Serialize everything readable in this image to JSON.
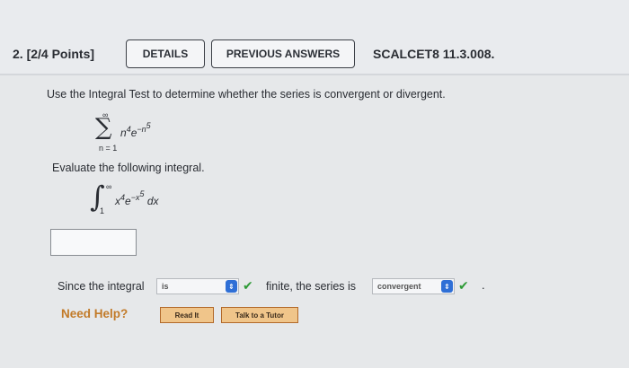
{
  "question": {
    "number": "2. [2/4 Points]",
    "details_label": "DETAILS",
    "previous_answers_label": "PREVIOUS ANSWERS",
    "code": "SCALCET8 11.3.008."
  },
  "problem": {
    "prompt": "Use the Integral Test to determine whether the series is convergent or divergent.",
    "series": {
      "symbol": "∑",
      "upper": "∞",
      "lower": "n = 1",
      "term_base1": "n",
      "term_exp1": "4",
      "term_base2": "e",
      "term_exp2": "−n",
      "term_exp2_sup": "5"
    },
    "evaluate_label": "Evaluate the following integral.",
    "integral": {
      "symbol": "∫",
      "upper": "∞",
      "lower": "1",
      "term_base1": "x",
      "term_exp1": "4",
      "term_base2": "e",
      "term_exp2": "−x",
      "term_exp2_sup": "5",
      "dx": "dx"
    },
    "answer_value": ""
  },
  "conclusion": {
    "since_label": "Since the integral",
    "select1_value": "is",
    "finite_label": "finite, the series is",
    "select2_value": "convergent",
    "period": "."
  },
  "help": {
    "label": "Need Help?",
    "read_it": "Read It",
    "talk_tutor": "Talk to a Tutor"
  },
  "icons": {
    "check": "checkmark-icon",
    "select_arrow": "updown-arrow-icon"
  },
  "colors": {
    "check": "#2e9a36",
    "select_arrow_bg": "#2f6fd6",
    "help_text": "#c27a28",
    "help_button_bg": "#f0c58a"
  }
}
